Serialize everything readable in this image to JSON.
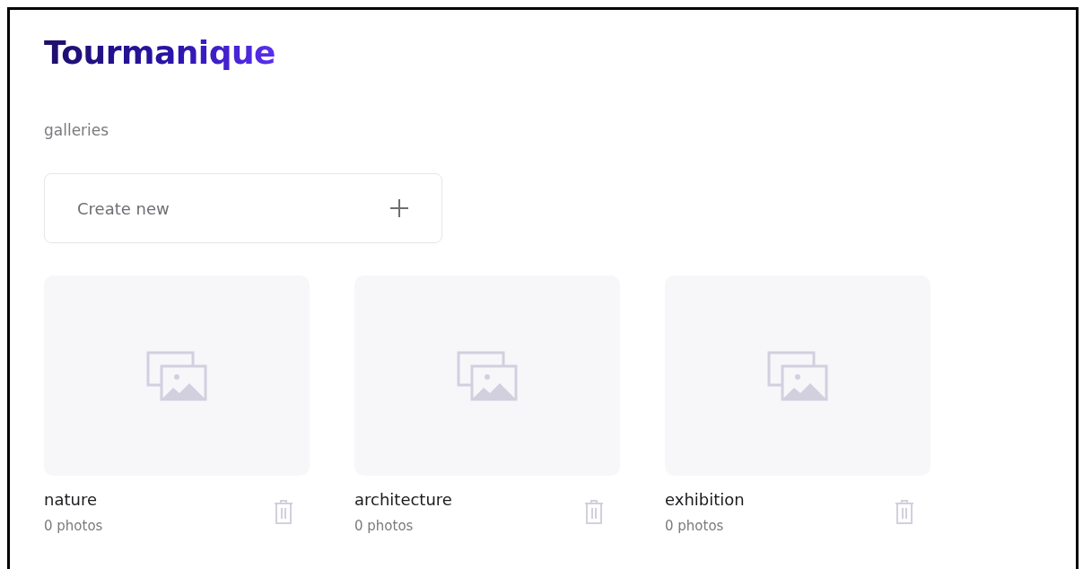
{
  "logo": "Tourmanique",
  "section_title": "galleries",
  "create_button": {
    "label": "Create new"
  },
  "galleries": [
    {
      "name": "nature",
      "count": "0 photos"
    },
    {
      "name": "architecture",
      "count": "0 photos"
    },
    {
      "name": "exhibition",
      "count": "0 photos"
    }
  ]
}
